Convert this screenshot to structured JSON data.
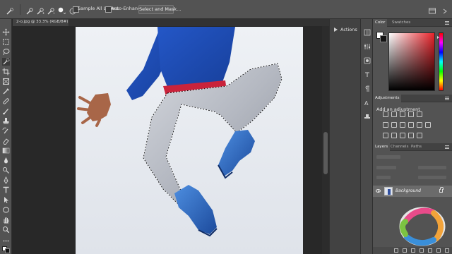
{
  "options_bar": {
    "sample_all_layers": "Sample All Layers",
    "auto_enhance": "Auto-Enhance",
    "select_and_mask": "Select and Mask..."
  },
  "document": {
    "tab_title": "2-o.jpg @ 33.3% (RGB/8#) *"
  },
  "actions_panel": {
    "label": "Actions"
  },
  "color_panel": {
    "tabs": [
      "Color",
      "Swatches"
    ],
    "hue_color": "#e8232a",
    "foreground": "#ffffff",
    "background": "#141414"
  },
  "adjustments_panel": {
    "tab": "Adjustments",
    "title": "Add an adjustment"
  },
  "layers_panel": {
    "tabs": [
      "Layers",
      "Channels",
      "Paths"
    ],
    "layer_name": "Background"
  },
  "colors": {
    "ui_dark": "#282828",
    "ui_mid": "#535353",
    "panel_dark": "#424242"
  }
}
